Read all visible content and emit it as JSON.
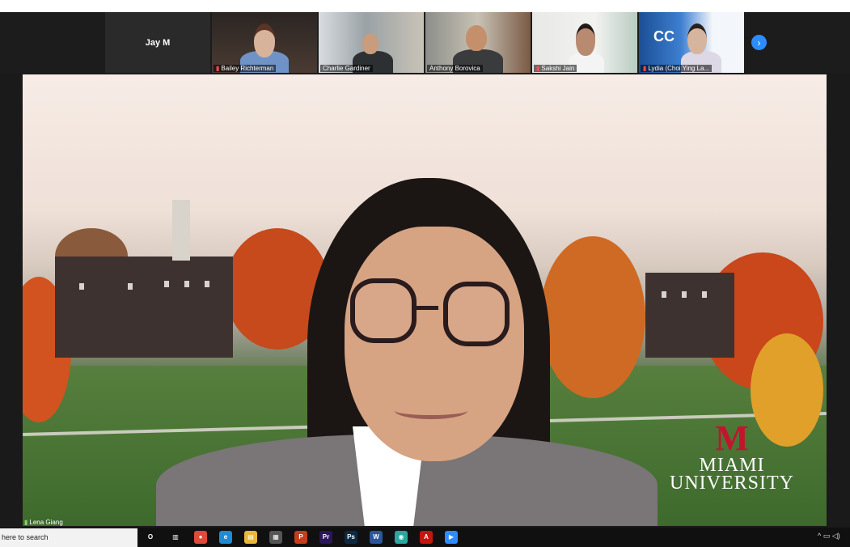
{
  "meeting": {
    "active_speaker_tile_name": "Jay M",
    "participants": [
      {
        "name": "Bailey Richterman",
        "muted": true
      },
      {
        "name": "Charlie Gardiner",
        "muted": false
      },
      {
        "name": "Anthony Borovica",
        "muted": false
      },
      {
        "name": "Sakshi Jain",
        "muted": true
      },
      {
        "name": "Lydia (Choi Ying La...",
        "muted": true
      }
    ],
    "next_page_icon": "chevron-right-icon",
    "main_video": {
      "speaker_name": "Lena Giang",
      "background_logo_text": "MIAMI\nUNIVERSITY",
      "logo_letter": "M"
    }
  },
  "taskbar": {
    "search_text": "here to search",
    "icons": [
      {
        "name": "cortana-icon",
        "glyph": "O",
        "color": "#101010"
      },
      {
        "name": "task-view-icon",
        "glyph": "▥",
        "color": "#101010"
      },
      {
        "name": "chrome-icon",
        "glyph": "●",
        "color": "#e04a3a"
      },
      {
        "name": "edge-icon",
        "glyph": "e",
        "color": "#1f8ad6"
      },
      {
        "name": "file-explorer-icon",
        "glyph": "▤",
        "color": "#e8b83a"
      },
      {
        "name": "store-icon",
        "glyph": "▦",
        "color": "#555555"
      },
      {
        "name": "powerpoint-icon",
        "glyph": "P",
        "color": "#c43e1c"
      },
      {
        "name": "premiere-icon",
        "glyph": "Pr",
        "color": "#2a1659"
      },
      {
        "name": "photoshop-icon",
        "glyph": "Ps",
        "color": "#0c2a44"
      },
      {
        "name": "word-icon",
        "glyph": "W",
        "color": "#2b579a"
      },
      {
        "name": "app-icon",
        "glyph": "◉",
        "color": "#2aa7a1"
      },
      {
        "name": "acrobat-icon",
        "glyph": "A",
        "color": "#c4160f"
      },
      {
        "name": "zoom-icon",
        "glyph": "▶",
        "color": "#2d8cff"
      }
    ],
    "tray": "^ ▭ ◁)"
  }
}
